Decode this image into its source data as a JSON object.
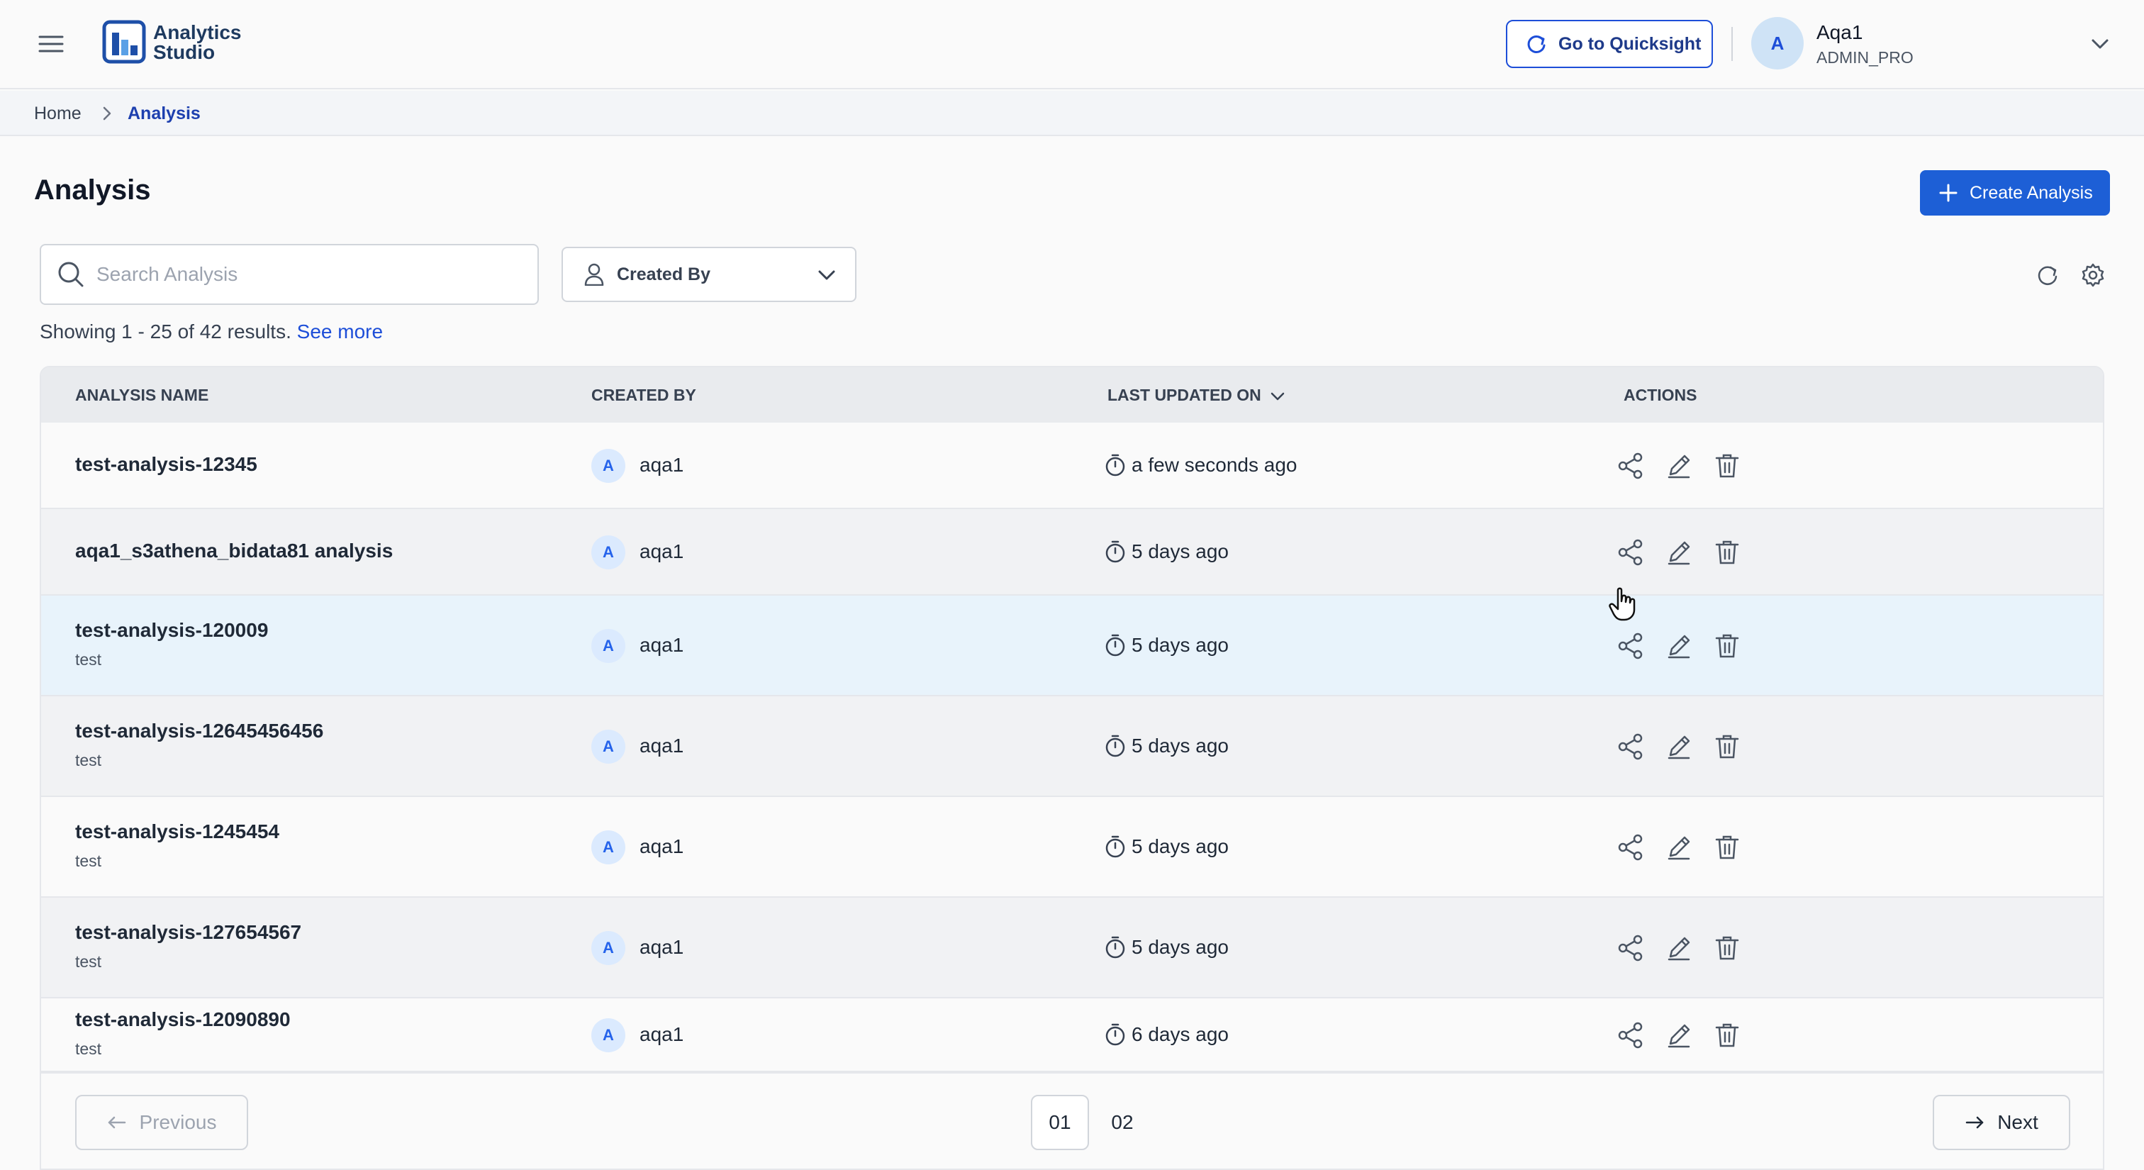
{
  "header": {
    "brand": {
      "line1": "Analytics",
      "line2": "Studio"
    },
    "quicksight_label": "Go to Quicksight",
    "user": {
      "initial": "A",
      "name": "Aqa1",
      "role": "ADMIN_PRO"
    }
  },
  "breadcrumb": {
    "home": "Home",
    "current": "Analysis"
  },
  "page": {
    "title": "Analysis",
    "create_label": "Create Analysis"
  },
  "filters": {
    "search_placeholder": "Search Analysis",
    "created_by_label": "Created By"
  },
  "results": {
    "summary": "Showing 1 - 25 of 42 results.",
    "see_more": "See more"
  },
  "table": {
    "columns": [
      "ANALYSIS NAME",
      "CREATED BY",
      "LAST UPDATED ON",
      "ACTIONS"
    ],
    "sorted_column": "LAST UPDATED ON",
    "rows": [
      {
        "name": "test-analysis-12345",
        "description": "",
        "creator_initial": "A",
        "creator": "aqa1",
        "updated": "a few seconds ago"
      },
      {
        "name": "aqa1_s3athena_bidata81 analysis",
        "description": "",
        "creator_initial": "A",
        "creator": "aqa1",
        "updated": "5 days ago"
      },
      {
        "name": "test-analysis-120009",
        "description": "test",
        "creator_initial": "A",
        "creator": "aqa1",
        "updated": "5 days ago",
        "highlighted": true
      },
      {
        "name": "test-analysis-12645456456",
        "description": "test",
        "creator_initial": "A",
        "creator": "aqa1",
        "updated": "5 days ago"
      },
      {
        "name": "test-analysis-1245454",
        "description": "test",
        "creator_initial": "A",
        "creator": "aqa1",
        "updated": "5 days ago"
      },
      {
        "name": "test-analysis-127654567",
        "description": "test",
        "creator_initial": "A",
        "creator": "aqa1",
        "updated": "5 days ago"
      },
      {
        "name": "test-analysis-12090890",
        "description": "test",
        "creator_initial": "A",
        "creator": "aqa1",
        "updated": "6 days ago"
      }
    ],
    "actions": [
      "share-icon",
      "edit-icon",
      "trash-icon"
    ]
  },
  "pagination": {
    "previous_label": "Previous",
    "next_label": "Next",
    "pages": [
      "01",
      "02"
    ],
    "current_page": "01"
  },
  "colors": {
    "primary": "#1d5fd6",
    "brand_text": "#1e3a5f",
    "link": "#1d4ed8",
    "highlight_row": "#e8f3fb",
    "alt_row": "#f1f2f4"
  }
}
